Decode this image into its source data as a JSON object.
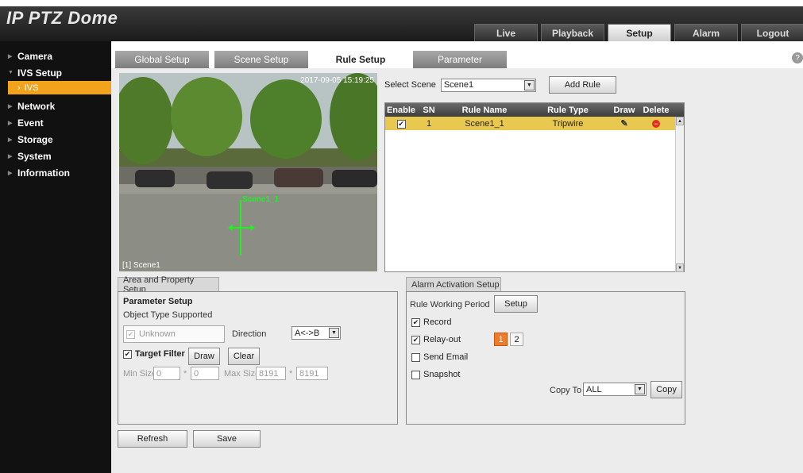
{
  "app": {
    "title": "IP PTZ Dome"
  },
  "top_nav": [
    {
      "label": "Live",
      "active": false
    },
    {
      "label": "Playback",
      "active": false
    },
    {
      "label": "Setup",
      "active": true
    },
    {
      "label": "Alarm",
      "active": false
    },
    {
      "label": "Logout",
      "active": false
    }
  ],
  "sidebar": {
    "items": [
      {
        "label": "Camera"
      },
      {
        "label": "IVS Setup",
        "expanded": true
      },
      {
        "label": "Network"
      },
      {
        "label": "Event"
      },
      {
        "label": "Storage"
      },
      {
        "label": "System"
      },
      {
        "label": "Information"
      }
    ],
    "sub_item": {
      "label": "IVS",
      "active": true
    }
  },
  "tabs": [
    {
      "label": "Global Setup"
    },
    {
      "label": "Scene Setup"
    },
    {
      "label": "Rule Setup",
      "active": true
    },
    {
      "label": "Parameter"
    }
  ],
  "camera": {
    "timestamp": "2017-09-05 15:19:25",
    "label": "[1] Scene1",
    "rule_overlay": "Scene1_1"
  },
  "scene": {
    "label": "Select Scene",
    "value": "Scene1",
    "add_rule_label": "Add Rule"
  },
  "rule_table": {
    "headers": {
      "enable": "Enable",
      "sn": "SN",
      "name": "Rule Name",
      "type": "Rule Type",
      "draw": "Draw",
      "delete": "Delete"
    },
    "rows": [
      {
        "enabled": true,
        "sn": "1",
        "name": "Scene1_1",
        "type": "Tripwire"
      }
    ]
  },
  "area_panel": {
    "tab_label": "Area and Property Setup",
    "param_title": "Parameter Setup",
    "object_type_label": "Object Type Supported",
    "object_type_value": "Unknown",
    "direction_label": "Direction",
    "direction_value": "A<->B",
    "target_filter_label": "Target Filter",
    "draw_label": "Draw",
    "clear_label": "Clear",
    "min_size_label": "Min Size",
    "min_w": "0",
    "min_h": "0",
    "max_size_label": "Max Size",
    "max_w": "8191",
    "max_h": "8191",
    "times": "*"
  },
  "alarm_panel": {
    "tab_label": "Alarm Activation Setup",
    "period_label": "Rule Working Period",
    "setup_label": "Setup",
    "record_label": "Record",
    "relay_label": "Relay-out",
    "relay_1": "1",
    "relay_2": "2",
    "email_label": "Send Email",
    "snapshot_label": "Snapshot",
    "copy_to_label": "Copy To",
    "copy_to_value": "ALL",
    "copy_label": "Copy"
  },
  "footer": {
    "refresh_label": "Refresh",
    "save_label": "Save"
  },
  "colors": {
    "accent": "#f1a31c",
    "selected_row": "#e8c84f",
    "header_bg": "#1b1b1b"
  }
}
